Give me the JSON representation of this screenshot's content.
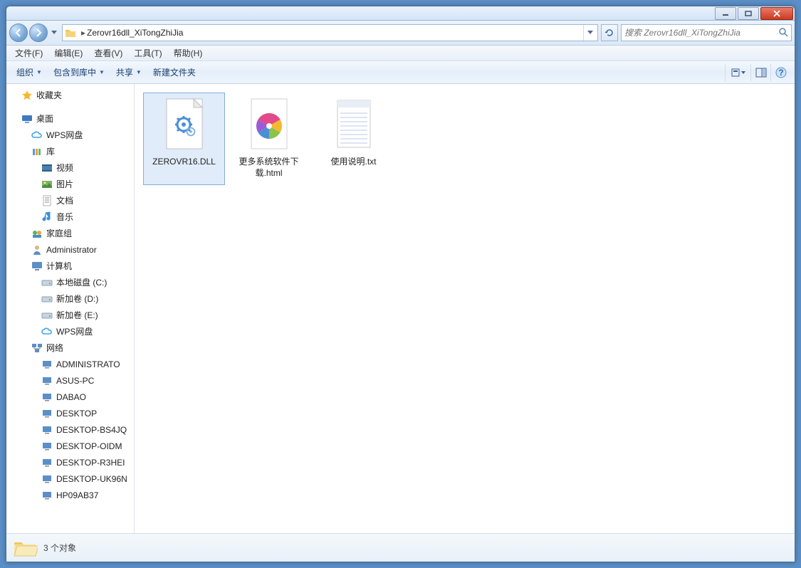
{
  "titlebar": {},
  "nav": {
    "path": "Zerovr16dll_XiTongZhiJia",
    "search_placeholder": "搜索 Zerovr16dll_XiTongZhiJia"
  },
  "menu": {
    "file": "文件(F)",
    "edit": "编辑(E)",
    "view": "查看(V)",
    "tools": "工具(T)",
    "help": "帮助(H)"
  },
  "toolbar": {
    "organize": "组织",
    "include": "包含到库中",
    "share": "共享",
    "newfolder": "新建文件夹"
  },
  "sidebar": {
    "favorites": "收藏夹",
    "desktop": "桌面",
    "wps": "WPS网盘",
    "libraries": "库",
    "videos": "视频",
    "pictures": "图片",
    "documents": "文档",
    "music": "音乐",
    "homegroup": "家庭组",
    "admin": "Administrator",
    "computer": "计算机",
    "localc": "本地磁盘 (C:)",
    "vold": "新加卷 (D:)",
    "vole": "新加卷 (E:)",
    "wps2": "WPS网盘",
    "network": "网络",
    "net": {
      "n0": "ADMINISTRATO",
      "n1": "ASUS-PC",
      "n2": "DABAO",
      "n3": "DESKTOP",
      "n4": "DESKTOP-BS4JQ",
      "n5": "DESKTOP-OIDM",
      "n6": "DESKTOP-R3HEI",
      "n7": "DESKTOP-UK96N",
      "n8": "HP09AB37"
    }
  },
  "files": {
    "f0": "ZEROVR16.DLL",
    "f1": "更多系统软件下载.html",
    "f2": "使用说明.txt"
  },
  "status": {
    "count": "3 个对象"
  }
}
